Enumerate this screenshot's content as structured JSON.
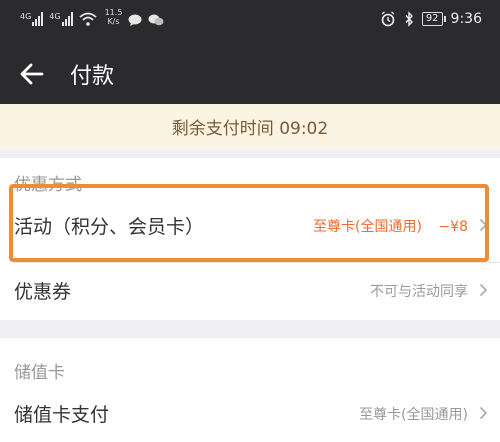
{
  "status_bar": {
    "network_1": "4G",
    "network_2": "4G",
    "speed_value": "11.5",
    "speed_unit": "K/s",
    "battery": "92",
    "time": "9:36"
  },
  "header": {
    "title": "付款"
  },
  "notice": {
    "text": "剩余支付时间 09:02"
  },
  "discount_section": {
    "label": "优惠方式",
    "rows": [
      {
        "label": "活动（积分、会员卡）",
        "card": "至尊卡(全国通用)",
        "amount": "−¥8"
      },
      {
        "label": "优惠券",
        "value": "不可与活动同享"
      }
    ]
  },
  "stored_value_section": {
    "label": "储值卡",
    "rows": [
      {
        "label": "储值卡支付",
        "value": "至尊卡(全国通用)"
      }
    ]
  },
  "colors": {
    "accent_orange": "#f26a2e",
    "highlight_border": "#f28c34",
    "header_bg": "#2b2b2d"
  }
}
